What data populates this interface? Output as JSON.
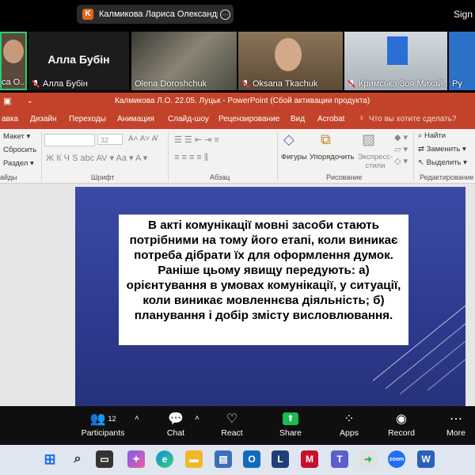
{
  "zoom": {
    "share_badge": "K",
    "share_name": "Калмикова Лариса Олександрівн",
    "more_glyph": "···",
    "sign_text": "Sign"
  },
  "participants": [
    {
      "name": "са О...",
      "bg": "#5a4a3c"
    },
    {
      "name": "Алла Бубін",
      "big": "Алла Бубін",
      "bg": "#1c1c1c"
    },
    {
      "name": "Olena Doroshchuk",
      "bg": "#6e6a5a"
    },
    {
      "name": "Oksana Tkachuk",
      "bg": "#7a6a58"
    },
    {
      "name": "Кримська Зоя Михай...",
      "bg": "#b7c0c6"
    },
    {
      "name": "Ру",
      "bg": "#2a4a7a"
    }
  ],
  "ppt": {
    "title": "Калмикова Л.О. 22.05. Луцьк - PowerPoint (Сбой активации продукта)",
    "tabs": [
      "авка",
      "Дизайн",
      "Переходы",
      "Анимация",
      "Слайд-шоу",
      "Рецензирование",
      "Вид",
      "Acrobat"
    ],
    "tell_me": "Что вы хотите сделать?",
    "ribbon": {
      "layout": "Макет",
      "reset": "Сбросить",
      "section": "Раздел",
      "font_size": "32",
      "font_group": "Шрифт",
      "paragraph_group": "Абзац",
      "drawing_group": "Рисование",
      "editing_group": "Редактирование",
      "slides_group": "айды",
      "shapes": "Фигуры",
      "arrange": "Упорядочить",
      "express": "Экспресс-",
      "styles": "стили",
      "find": "Найти",
      "replace": "Заменить",
      "select": "Выделить"
    },
    "slide_text": "В акті комунікації мовні засоби стають потрібними на тому його етапі, коли виникає потреба дібрати їх для оформлення думок. Раніше цьому явищу передують: а) орієнтування в умовах комунікації, у ситуації, коли виникає мовленнєва діяльність; б) планування і добір змісту висловлювання."
  },
  "controls": [
    {
      "label": "Participants",
      "icon": "participants-icon",
      "count": "12"
    },
    {
      "label": "Chat",
      "icon": "chat-icon"
    },
    {
      "label": "React",
      "icon": "heart-icon"
    },
    {
      "label": "Share",
      "icon": "share-icon"
    },
    {
      "label": "Apps",
      "icon": "apps-icon"
    },
    {
      "label": "Record",
      "icon": "record-icon"
    },
    {
      "label": "More",
      "icon": "more-icon"
    }
  ],
  "taskbar": {
    "l_letter": "L",
    "m_letter": "M",
    "w_letter": "W",
    "zoom_text": "zoom"
  },
  "colors": {
    "ppt_accent": "#c2432a",
    "share_green": "#1db954"
  }
}
